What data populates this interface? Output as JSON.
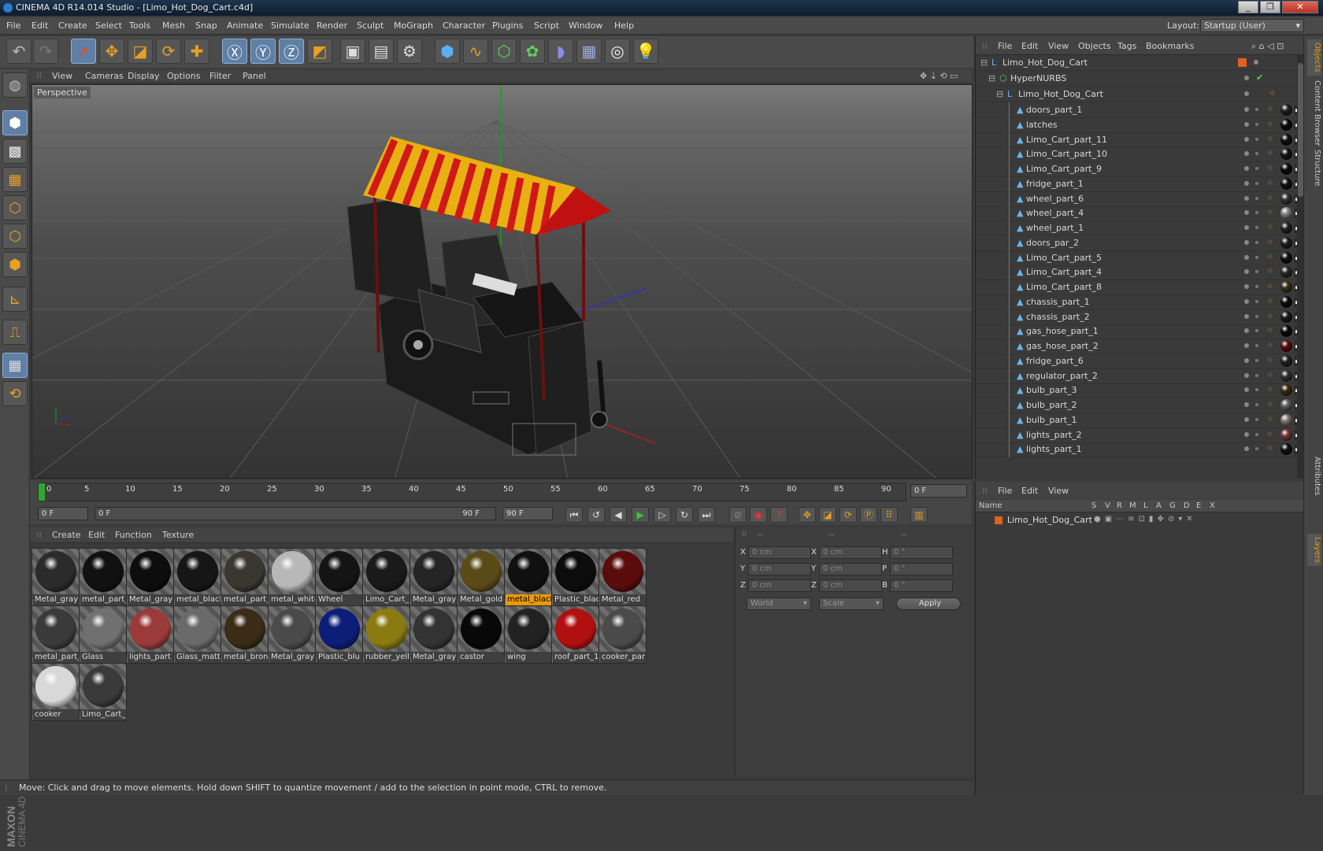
{
  "window": {
    "title": "CINEMA 4D R14.014 Studio - [Limo_Hot_Dog_Cart.c4d]"
  },
  "menu": [
    "File",
    "Edit",
    "Create",
    "Select",
    "Tools",
    "Mesh",
    "Snap",
    "Animate",
    "Simulate",
    "Render",
    "Sculpt",
    "MoGraph",
    "Character",
    "Plugins",
    "Script",
    "Window",
    "Help"
  ],
  "layout": {
    "label": "Layout:",
    "value": "Startup (User)"
  },
  "viewport": {
    "menu": [
      "View",
      "Cameras",
      "Display",
      "Options",
      "Filter",
      "Panel"
    ],
    "label": "Perspective"
  },
  "timeline": {
    "ticks": [
      "0",
      "5",
      "10",
      "15",
      "20",
      "25",
      "30",
      "35",
      "40",
      "45",
      "50",
      "55",
      "60",
      "65",
      "70",
      "75",
      "80",
      "85",
      "90"
    ],
    "current": "0 F"
  },
  "playback": {
    "start": "0 F",
    "range_start": "0 F",
    "range_end": "90 F",
    "end": "90 F"
  },
  "materials": {
    "menu": [
      "Create",
      "Edit",
      "Function",
      "Texture"
    ],
    "items": [
      {
        "name": "Metal_gray",
        "color": "#2b2b2b"
      },
      {
        "name": "metal_part_",
        "color": "#111"
      },
      {
        "name": "Metal_gray",
        "color": "#0d0d0d"
      },
      {
        "name": "metal_black",
        "color": "#161616"
      },
      {
        "name": "metal_part_",
        "color": "#3a3630"
      },
      {
        "name": "metal_white",
        "color": "#b8b8b8"
      },
      {
        "name": "Wheel",
        "color": "#141414"
      },
      {
        "name": "Limo_Cart_",
        "color": "#1a1a1a"
      },
      {
        "name": "Metal_gray",
        "color": "#252525"
      },
      {
        "name": "Metal_gold",
        "color": "#5a4a18"
      },
      {
        "name": "metal_black",
        "color": "#101010",
        "selected": true
      },
      {
        "name": "Plastic_blac",
        "color": "#0c0c0c"
      },
      {
        "name": "Metal_red",
        "color": "#5a0c0c"
      },
      {
        "name": "metal_part_",
        "color": "#3a3a3a"
      },
      {
        "name": "Glass",
        "color": "#707070"
      },
      {
        "name": "lights_part",
        "color": "#9a3a3a"
      },
      {
        "name": "Glass_matt",
        "color": "#6a6a6a"
      },
      {
        "name": "metal_bron",
        "color": "#3a2c16"
      },
      {
        "name": "Metal_gray",
        "color": "#4a4a4a"
      },
      {
        "name": "Plastic_blu",
        "color": "#0c1e78"
      },
      {
        "name": "rubber_yell",
        "color": "#8a7a10"
      },
      {
        "name": "Metal_gray",
        "color": "#333"
      },
      {
        "name": "castor",
        "color": "#080808"
      },
      {
        "name": "wing",
        "color": "#222"
      },
      {
        "name": "roof_part_1",
        "color": "#b01010"
      },
      {
        "name": "cooker_par",
        "color": "#4a4a4a"
      },
      {
        "name": "cooker",
        "color": "#d8d8d8"
      },
      {
        "name": "Limo_Cart_",
        "color": "#3a3a3a"
      }
    ]
  },
  "coordinates": {
    "headers": [
      "--",
      "--",
      "--"
    ],
    "rows": [
      {
        "a": "X",
        "av": "0 cm",
        "b": "X",
        "bv": "0 cm",
        "c": "H",
        "cv": "0 °"
      },
      {
        "a": "Y",
        "av": "0 cm",
        "b": "Y",
        "bv": "0 cm",
        "c": "P",
        "cv": "0 °"
      },
      {
        "a": "Z",
        "av": "0 cm",
        "b": "Z",
        "bv": "0 cm",
        "c": "B",
        "cv": "0 °"
      }
    ],
    "world": "World",
    "scale": "Scale",
    "apply": "Apply"
  },
  "objects": {
    "menu": [
      "File",
      "Edit",
      "View",
      "Objects",
      "Tags",
      "Bookmarks"
    ],
    "root": "Limo_Hot_Dog_Cart",
    "hypernurbs": "HyperNURBS",
    "group": "Limo_Hot_Dog_Cart",
    "children": [
      {
        "name": "doors_part_1",
        "tag": "#222"
      },
      {
        "name": "latches",
        "tag": "#0a0a0a"
      },
      {
        "name": "Limo_Cart_part_11",
        "tag": "#111"
      },
      {
        "name": "Limo_Cart_part_10",
        "tag": "#151515"
      },
      {
        "name": "Limo_Cart_part_9",
        "tag": "#0c0c0c"
      },
      {
        "name": "fridge_part_1",
        "tag": "#111"
      },
      {
        "name": "wheel_part_6",
        "tag": "#333"
      },
      {
        "name": "wheel_part_4",
        "tag": "#888"
      },
      {
        "name": "wheel_part_1",
        "tag": "#222"
      },
      {
        "name": "doors_par_2",
        "tag": "#1e1e1e"
      },
      {
        "name": "Limo_Cart_part_5",
        "tag": "#111"
      },
      {
        "name": "Limo_Cart_part_4",
        "tag": "#2a2a2a"
      },
      {
        "name": "Limo_Cart_part_8",
        "tag": "#3a3218"
      },
      {
        "name": "chassis_part_1",
        "tag": "#0c0c0c"
      },
      {
        "name": "chassis_part_2",
        "tag": "#1a1a1a"
      },
      {
        "name": "gas_hose_part_1",
        "tag": "#0a0a0a"
      },
      {
        "name": "gas_hose_part_2",
        "tag": "#5a0c0c"
      },
      {
        "name": "fridge_part_6",
        "tag": "#222"
      },
      {
        "name": "regulator_part_2",
        "tag": "#333"
      },
      {
        "name": "bulb_part_3",
        "tag": "#3a3010"
      },
      {
        "name": "bulb_part_2",
        "tag": "#666"
      },
      {
        "name": "bulb_part_1",
        "tag": "#8a7a7a"
      },
      {
        "name": "lights_part_2",
        "tag": "#7a3a3a"
      },
      {
        "name": "lights_part_1",
        "tag": "#111"
      }
    ]
  },
  "layers": {
    "menu": [
      "File",
      "Edit",
      "View"
    ],
    "columns": [
      "Name",
      "S",
      "V",
      "R",
      "M",
      "L",
      "A",
      "G",
      "D",
      "E",
      "X"
    ],
    "row": "Limo_Hot_Dog_Cart"
  },
  "side_tabs": [
    "Objects",
    "Content Browser",
    "Structure",
    "Attributes",
    "Layers"
  ],
  "status": "Move: Click and drag to move elements. Hold down SHIFT to quantize movement / add to the selection in point mode, CTRL to remove.",
  "brand": {
    "maker": "MAXON",
    "product": "CINEMA 4D"
  }
}
